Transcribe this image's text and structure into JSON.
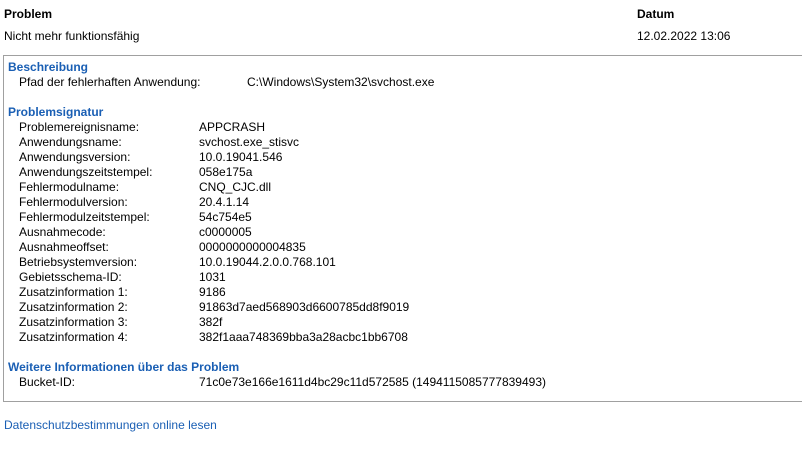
{
  "list_header": {
    "problem_label": "Problem",
    "date_label": "Datum"
  },
  "list_row": {
    "problem": "Nicht mehr funktionsfähig",
    "date": "12.02.2022 13:06"
  },
  "beschreibung": {
    "title": "Beschreibung",
    "path_label": "Pfad der fehlerhaften Anwendung:",
    "path_value": "C:\\Windows\\System32\\svchost.exe"
  },
  "signatur": {
    "title": "Problemsignatur",
    "rows": [
      {
        "label": "Problemereignisname:",
        "value": "APPCRASH"
      },
      {
        "label": "Anwendungsname:",
        "value": "svchost.exe_stisvc"
      },
      {
        "label": "Anwendungsversion:",
        "value": "10.0.19041.546"
      },
      {
        "label": "Anwendungszeitstempel:",
        "value": "058e175a"
      },
      {
        "label": "Fehlermodulname:",
        "value": "CNQ_CJC.dll"
      },
      {
        "label": "Fehlermodulversion:",
        "value": "20.4.1.14"
      },
      {
        "label": "Fehlermodulzeitstempel:",
        "value": "54c754e5"
      },
      {
        "label": "Ausnahmecode:",
        "value": "c0000005"
      },
      {
        "label": "Ausnahmeoffset:",
        "value": "0000000000004835"
      },
      {
        "label": "Betriebsystemversion:",
        "value": "10.0.19044.2.0.0.768.101"
      },
      {
        "label": "Gebietsschema-ID:",
        "value": "1031"
      },
      {
        "label": "Zusatzinformation 1:",
        "value": "9186"
      },
      {
        "label": "Zusatzinformation 2:",
        "value": "91863d7aed568903d6600785dd8f9019"
      },
      {
        "label": "Zusatzinformation 3:",
        "value": "382f"
      },
      {
        "label": "Zusatzinformation 4:",
        "value": "382f1aaa748369bba3a28acbc1bb6708"
      }
    ]
  },
  "weitere": {
    "title": "Weitere Informationen über das Problem",
    "bucket_label": "Bucket-ID:",
    "bucket_value": "71c0e73e166e1611d4bc29c11d572585 (1494115085777839493)"
  },
  "privacy_link": "Datenschutzbestimmungen online lesen",
  "colors": {
    "accent": "#1a5fb4",
    "border": "#a0a0a0"
  }
}
